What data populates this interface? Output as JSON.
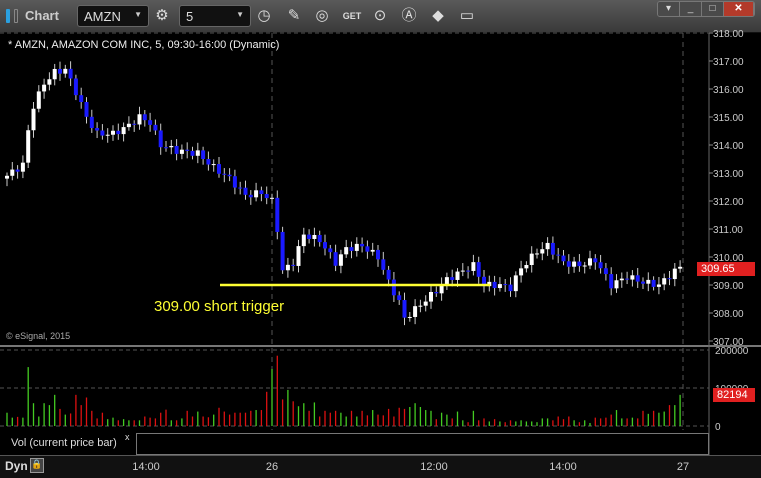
{
  "window": {
    "title": "Chart",
    "symbol": "AMZN",
    "interval": "5"
  },
  "toolbar": {
    "icons": [
      "gear-icon",
      "clock-icon",
      "pencil-icon",
      "indicator-icon",
      "get-icon",
      "play-icon",
      "alert-icon",
      "link-icon",
      "comment-icon"
    ]
  },
  "chart_info": "* AMZN, AMAZON COM INC, 5, 09:30-16:00 (Dynamic)",
  "copyright": "© eSignal, 2015",
  "annotation": {
    "text": "309.00 short trigger",
    "price": 309.0,
    "color": "#ffff33"
  },
  "price_axis": {
    "ticks": [
      "318.00",
      "317.00",
      "316.00",
      "315.00",
      "314.00",
      "313.00",
      "312.00",
      "311.00",
      "310.00",
      "309.00",
      "308.00",
      "307.00"
    ],
    "last": "309.65"
  },
  "volume_axis": {
    "ticks": [
      "200000",
      "100000",
      "0"
    ],
    "last": "82194",
    "panel_label": "Vol (current price bar)",
    "close": "x"
  },
  "time_axis": {
    "labels": [
      "14:00",
      "26",
      "12:00",
      "14:00",
      "27"
    ],
    "mode": "Dyn"
  },
  "colors": {
    "up": "#ffffff",
    "down": "#1a1aff",
    "vol_up": "#44cc22",
    "vol_down": "#dd1111",
    "trigger": "#ffff33"
  },
  "chart_data": {
    "type": "candlestick",
    "ylim": [
      307,
      318
    ],
    "price_path": [
      [
        0,
        312.9
      ],
      [
        3,
        313.3
      ],
      [
        4,
        314.5
      ],
      [
        5,
        315.4
      ],
      [
        7,
        316.2
      ],
      [
        9,
        316.6
      ],
      [
        11,
        316.7
      ],
      [
        13,
        315.9
      ],
      [
        15,
        315.0
      ],
      [
        17,
        314.4
      ],
      [
        20,
        314.4
      ],
      [
        23,
        314.7
      ],
      [
        25,
        315.0
      ],
      [
        27,
        314.8
      ],
      [
        29,
        314.0
      ],
      [
        32,
        313.8
      ],
      [
        36,
        313.7
      ],
      [
        39,
        313.2
      ],
      [
        42,
        312.8
      ],
      [
        45,
        312.2
      ],
      [
        48,
        312.3
      ],
      [
        50,
        312.0
      ],
      [
        51,
        311.0
      ],
      [
        52,
        309.5
      ],
      [
        54,
        309.8
      ],
      [
        56,
        310.8
      ],
      [
        59,
        310.6
      ],
      [
        62,
        309.8
      ],
      [
        64,
        310.3
      ],
      [
        67,
        310.4
      ],
      [
        70,
        310.0
      ],
      [
        72,
        309.1
      ],
      [
        74,
        308.4
      ],
      [
        75,
        307.8
      ],
      [
        78,
        308.3
      ],
      [
        81,
        308.8
      ],
      [
        83,
        309.2
      ],
      [
        86,
        309.5
      ],
      [
        88,
        309.7
      ],
      [
        90,
        309.0
      ],
      [
        93,
        309.0
      ],
      [
        95,
        308.9
      ],
      [
        97,
        309.6
      ],
      [
        100,
        310.2
      ],
      [
        102,
        310.4
      ],
      [
        105,
        309.8
      ],
      [
        108,
        309.7
      ],
      [
        111,
        309.9
      ],
      [
        114,
        309.0
      ],
      [
        117,
        309.3
      ],
      [
        120,
        309.1
      ],
      [
        123,
        309.0
      ],
      [
        126,
        309.5
      ],
      [
        127,
        309.65
      ]
    ],
    "volume": [
      35,
      22,
      24,
      22,
      155,
      60,
      25,
      60,
      55,
      82,
      45,
      30,
      33,
      82,
      55,
      75,
      40,
      20,
      35,
      18,
      22,
      15,
      18,
      15,
      15,
      15,
      25,
      22,
      20,
      35,
      43,
      15,
      15,
      20,
      40,
      25,
      38,
      25,
      23,
      30,
      48,
      38,
      30,
      35,
      35,
      35,
      40,
      42,
      42,
      90,
      150,
      185,
      70,
      95,
      65,
      52,
      60,
      40,
      62,
      25,
      40,
      35,
      40,
      35,
      25,
      40,
      25,
      40,
      28,
      42,
      30,
      28,
      45,
      25,
      48,
      45,
      50,
      60,
      50,
      42,
      40,
      18,
      35,
      30,
      20,
      38,
      15,
      10,
      40,
      15,
      20,
      12,
      18,
      12,
      10,
      15,
      12,
      15,
      12,
      12,
      10,
      20,
      20,
      15,
      25,
      18,
      25,
      15,
      10,
      15,
      8,
      22,
      20,
      22,
      30,
      42,
      20,
      20,
      22,
      20,
      40,
      32,
      40,
      35,
      38,
      55,
      55,
      82
    ]
  }
}
